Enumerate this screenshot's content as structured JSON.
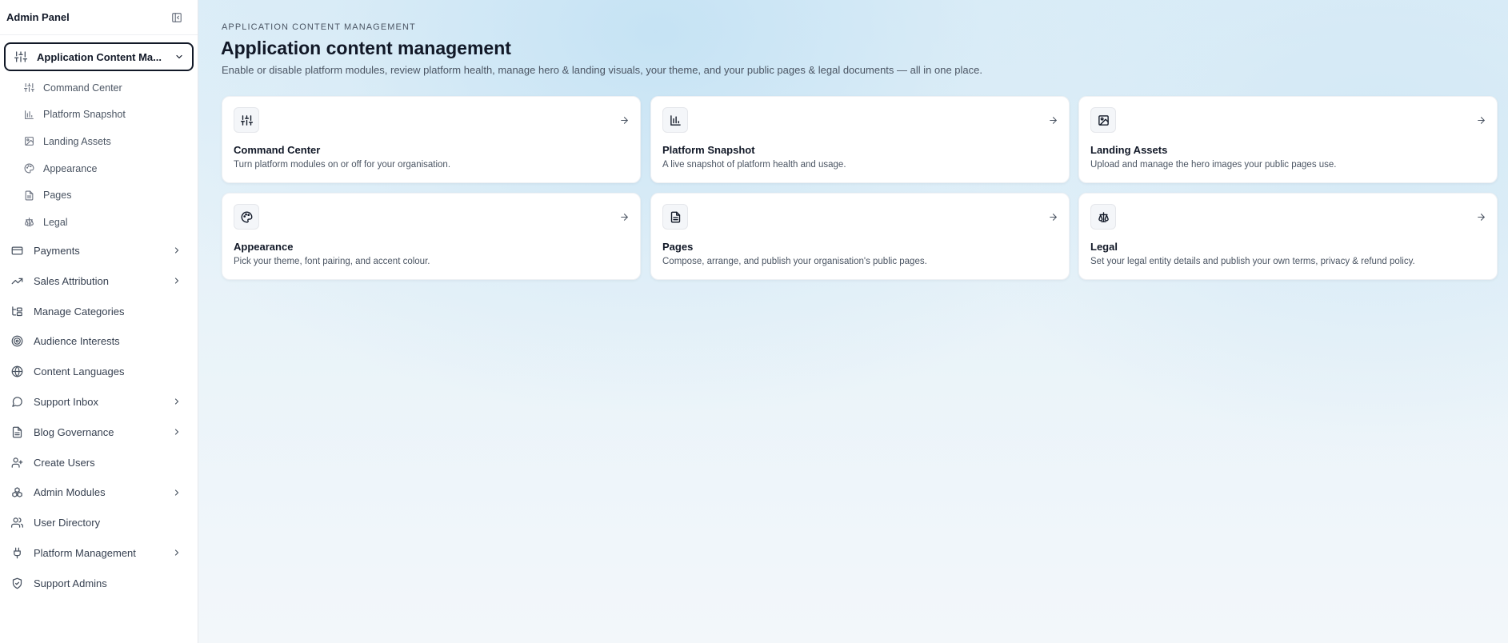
{
  "sidebar": {
    "title": "Admin Panel",
    "collapse_icon": "sidebar-collapse-icon",
    "active_group": {
      "label": "Application Content Ma...",
      "icon": "sliders-icon"
    },
    "subitems": [
      {
        "label": "Command Center",
        "icon": "sliders-icon"
      },
      {
        "label": "Platform Snapshot",
        "icon": "bar-chart-icon"
      },
      {
        "label": "Landing Assets",
        "icon": "image-icon"
      },
      {
        "label": "Appearance",
        "icon": "palette-icon"
      },
      {
        "label": "Pages",
        "icon": "file-text-icon"
      },
      {
        "label": "Legal",
        "icon": "scale-icon"
      }
    ],
    "items": [
      {
        "label": "Payments",
        "icon": "credit-card-icon",
        "expandable": true
      },
      {
        "label": "Sales Attribution",
        "icon": "trending-up-icon",
        "expandable": true
      },
      {
        "label": "Manage Categories",
        "icon": "folder-tree-icon",
        "expandable": false
      },
      {
        "label": "Audience Interests",
        "icon": "target-icon",
        "expandable": false
      },
      {
        "label": "Content Languages",
        "icon": "globe-icon",
        "expandable": false
      },
      {
        "label": "Support Inbox",
        "icon": "message-circle-icon",
        "expandable": true
      },
      {
        "label": "Blog Governance",
        "icon": "file-text-icon",
        "expandable": true
      },
      {
        "label": "Create Users",
        "icon": "user-plus-icon",
        "expandable": false
      },
      {
        "label": "Admin Modules",
        "icon": "boxes-icon",
        "expandable": true
      },
      {
        "label": "User Directory",
        "icon": "users-icon",
        "expandable": false
      },
      {
        "label": "Platform Management",
        "icon": "plug-icon",
        "expandable": true
      },
      {
        "label": "Support Admins",
        "icon": "shield-check-icon",
        "expandable": false
      }
    ]
  },
  "main": {
    "eyebrow": "APPLICATION CONTENT MANAGEMENT",
    "title": "Application content management",
    "subtitle": "Enable or disable platform modules, review platform health, manage hero & landing visuals, your theme, and your public pages & legal documents — all in one place.",
    "cards": [
      {
        "title": "Command Center",
        "description": "Turn platform modules on or off for your organisation.",
        "icon": "sliders-icon"
      },
      {
        "title": "Platform Snapshot",
        "description": "A live snapshot of platform health and usage.",
        "icon": "bar-chart-icon"
      },
      {
        "title": "Landing Assets",
        "description": "Upload and manage the hero images your public pages use.",
        "icon": "image-icon"
      },
      {
        "title": "Appearance",
        "description": "Pick your theme, font pairing, and accent colour.",
        "icon": "palette-icon"
      },
      {
        "title": "Pages",
        "description": "Compose, arrange, and publish your organisation's public pages.",
        "icon": "file-text-icon"
      },
      {
        "title": "Legal",
        "description": "Set your legal entity details and publish your own terms, privacy & refund policy.",
        "icon": "scale-icon"
      }
    ]
  }
}
